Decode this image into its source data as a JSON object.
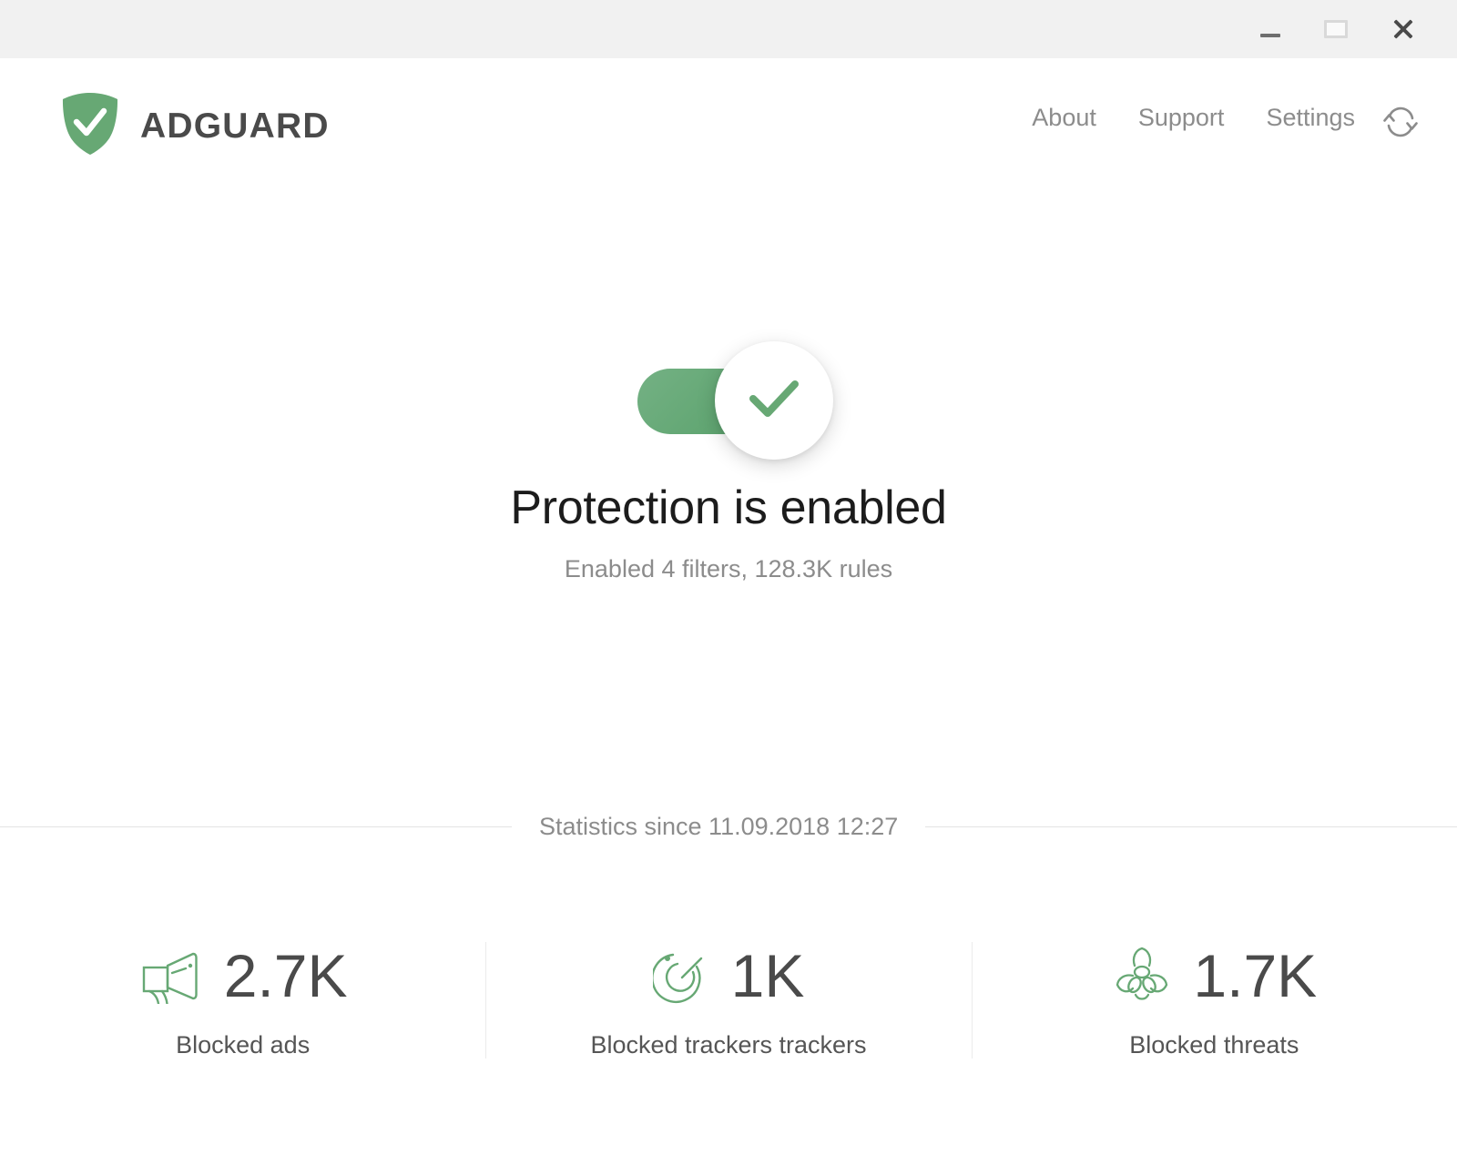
{
  "window": {
    "controls": [
      {
        "name": "minimize",
        "label": "Minimize"
      },
      {
        "name": "maximize",
        "label": "Maximize"
      },
      {
        "name": "close",
        "label": "Close"
      }
    ]
  },
  "header": {
    "brand_name": "ADGUARD",
    "logo_icon": "shield-check-icon",
    "nav": [
      {
        "label": "About"
      },
      {
        "label": "Support"
      },
      {
        "label": "Settings"
      }
    ],
    "refresh_icon": "refresh-sync-icon"
  },
  "protection": {
    "toggle_state": "on",
    "toggle_icon": "checkmark-icon",
    "title": "Protection is enabled",
    "subtitle": "Enabled 4 filters, 128.3K rules"
  },
  "statistics": {
    "since_label": "Statistics since 11.09.2018 12:27",
    "items": [
      {
        "icon": "megaphone-icon",
        "value": "2.7K",
        "label": "Blocked ads"
      },
      {
        "icon": "radar-tracker-icon",
        "value": "1K",
        "label": "Blocked trackers trackers"
      },
      {
        "icon": "biohazard-icon",
        "value": "1.7K",
        "label": "Blocked threats"
      }
    ]
  },
  "colors": {
    "brand_green": "#67a874",
    "titlebar_bg": "#f1f1f1",
    "text_dark": "#4a4a4a",
    "text_muted": "#8c8c8c"
  }
}
